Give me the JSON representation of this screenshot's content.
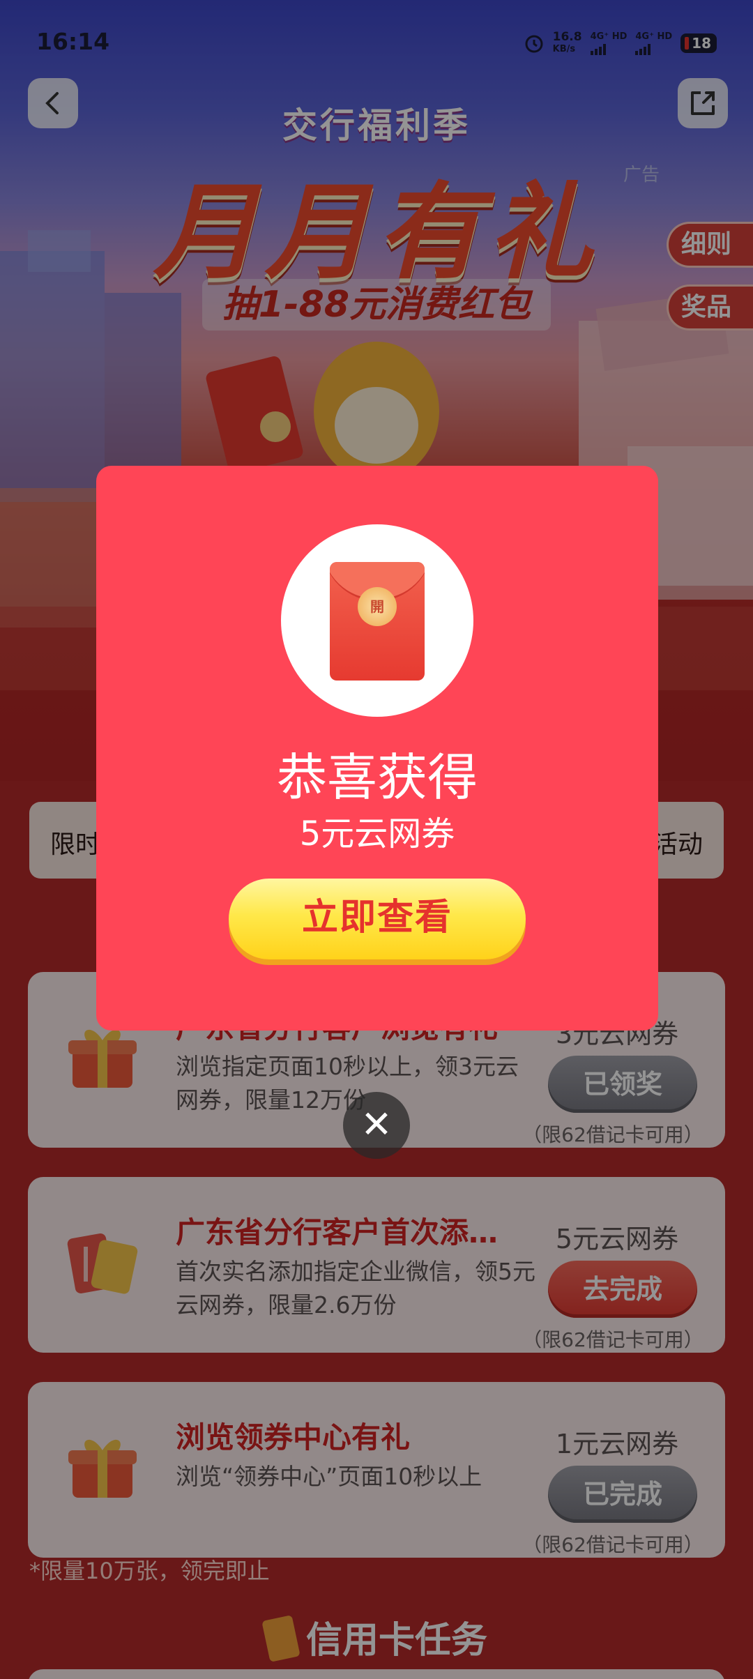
{
  "status_bar": {
    "time": "16:14",
    "net_speed_value": "16.8",
    "net_speed_unit": "KB/s",
    "sim1": "4G⁺ HD",
    "sim2": "4G⁺ HD",
    "battery": "18"
  },
  "header": {
    "back_icon": "chevron-left-icon",
    "share_icon": "share-icon",
    "subtitle": "交行福利季",
    "title": "月月有礼",
    "tagline": "抽1-88元消费红包",
    "ad_label": "广告",
    "rules_tab": "细则",
    "prizes_tab": "奖品"
  },
  "info_bar": {
    "left_text": "限时",
    "right_text": "活动"
  },
  "tasks": [
    {
      "title": "广东省分行客户浏览有礼",
      "desc": "浏览指定页面10秒以上，领3元云网券，限量12万份",
      "reward": "3元云网券",
      "button": "已领奖",
      "note": "（限62借记卡可用）",
      "icon": "gift-box-icon"
    },
    {
      "title": "广东省分行客户首次添…",
      "desc": "首次实名添加指定企业微信，领5元云网券，限量2.6万份",
      "reward": "5元云网券",
      "button": "去完成",
      "note": "（限62借记卡可用）",
      "icon": "card-icon"
    },
    {
      "title": "浏览领券中心有礼",
      "desc": "浏览“领券中心”页面10秒以上",
      "reward": "1元云网券",
      "button": "已完成",
      "note": "（限62借记卡可用）",
      "icon": "gift-box-icon"
    }
  ],
  "footnote": "*限量10万张，领完即止",
  "section_title": "信用卡任务",
  "modal": {
    "envelope_seal": "開",
    "title": "恭喜获得",
    "prize": "5元云网券",
    "cta": "立即查看",
    "close": "✕"
  },
  "colors": {
    "modal_bg": "#ff4556",
    "cta_yellow": "#ffe84a",
    "accent_red": "#d12424"
  }
}
